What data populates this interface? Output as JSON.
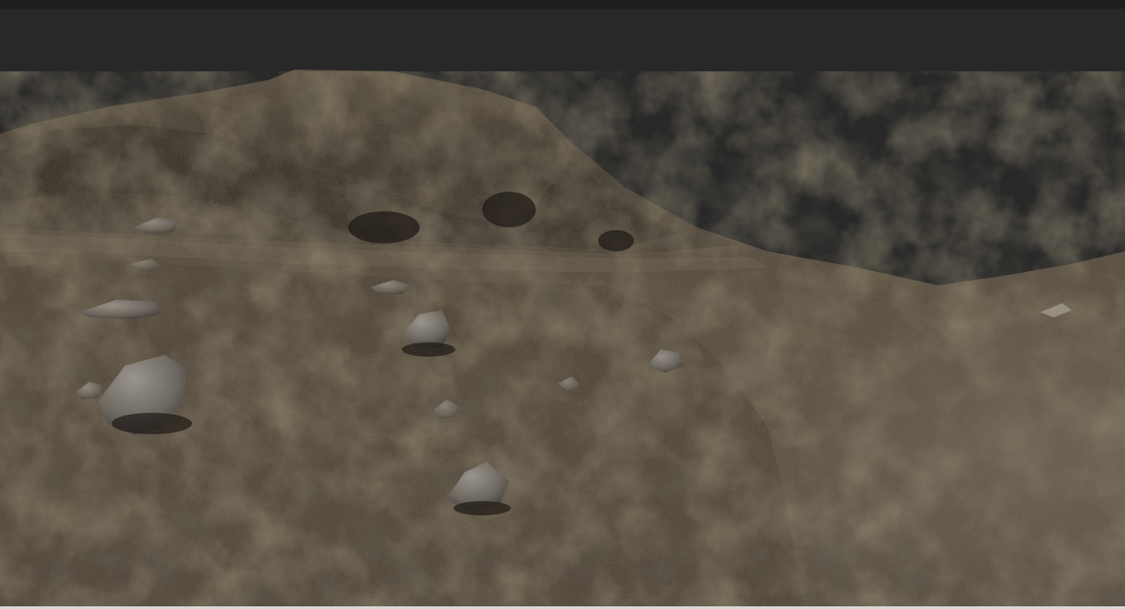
{
  "scene": {
    "type": "3d-terrain-render",
    "sky_color": "#282828",
    "terrain_palette": {
      "dark_soil": "#2a241c",
      "mid_soil": "#4a3f31",
      "light_soil": "#6b5b45",
      "dry_grass": "#7a6740",
      "rock": "#8c8880",
      "rock_shadow": "#3a3631"
    }
  }
}
